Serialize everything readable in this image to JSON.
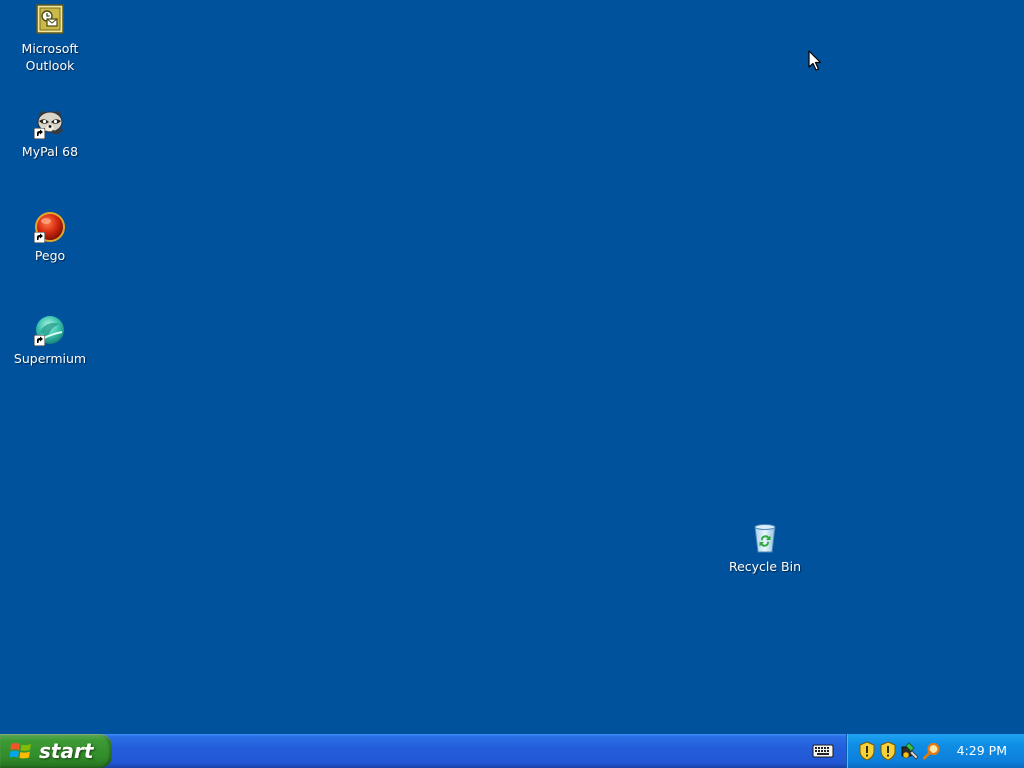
{
  "desktop": {
    "background_color": "#00529c",
    "icons": [
      {
        "label": "Microsoft\nOutlook",
        "icon": "outlook-icon"
      },
      {
        "label": "MyPal 68",
        "icon": "mypal-raccoon-icon"
      },
      {
        "label": "Pego",
        "icon": "pego-red-ball-icon"
      },
      {
        "label": "Supermium",
        "icon": "supermium-icon"
      },
      {
        "label": "Recycle Bin",
        "icon": "recycle-bin-icon"
      }
    ]
  },
  "taskbar": {
    "start_label": "start",
    "start_color": "#3c9a34",
    "bar_color": "#245edb",
    "tray_color": "#0f8ee6",
    "tray_icons": [
      "security-alert-shield-icon",
      "security-shield-icon",
      "network-tool-icon",
      "search-magnifier-icon"
    ],
    "clock": "4:29 PM"
  }
}
